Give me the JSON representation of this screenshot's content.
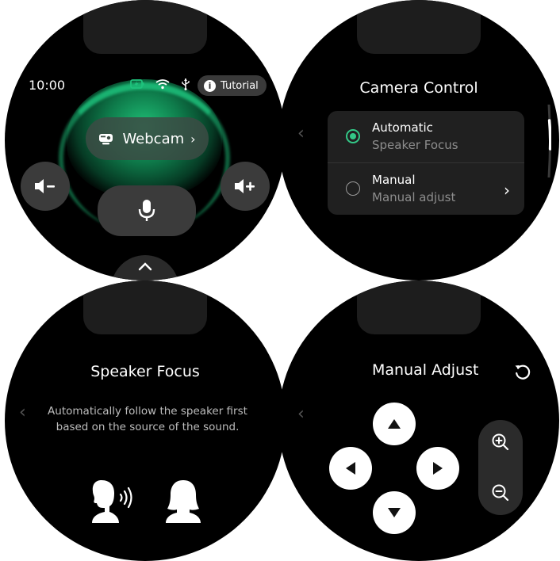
{
  "screen1": {
    "time": "10:00",
    "status_icons": [
      "battery-charging-icon",
      "wifi-icon",
      "usb-icon"
    ],
    "tutorial_label": "Tutorial",
    "webcam_label": "Webcam",
    "accent_color": "#1ec27c"
  },
  "screen2": {
    "title": "Camera Control",
    "options": [
      {
        "title": "Automatic",
        "subtitle": "Speaker Focus",
        "selected": true
      },
      {
        "title": "Manual",
        "subtitle": "Manual adjust",
        "selected": false
      }
    ],
    "accent_color": "#33c887"
  },
  "screen3": {
    "title": "Speaker Focus",
    "description": "Automatically follow the speaker first based on the source of the sound."
  },
  "screen4": {
    "title": "Manual Adjust"
  }
}
